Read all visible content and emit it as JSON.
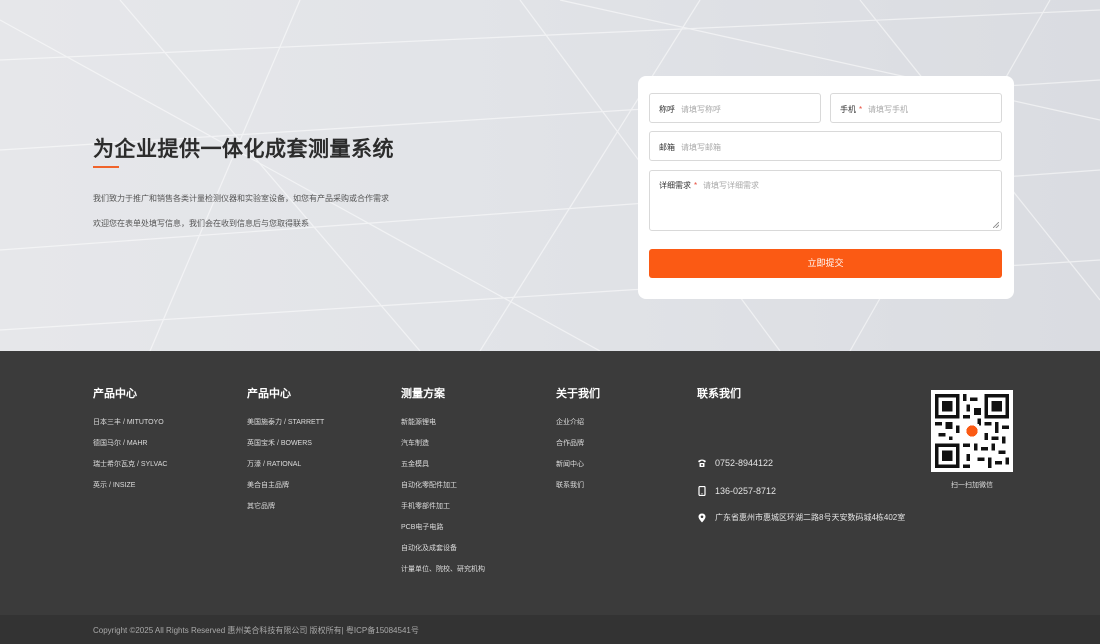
{
  "hero": {
    "title": "为企业提供一体化成套测量系统",
    "desc_line1": "我们致力于推广和销售各类计量检测仪器和实验室设备，如您有产品采购或合作需求",
    "desc_line2": "欢迎您在表单处填写信息，我们会在收到信息后与您取得联系"
  },
  "form": {
    "name_label": "称呼",
    "name_placeholder": "请填写称呼",
    "phone_label": "手机",
    "phone_placeholder": "请填写手机",
    "email_label": "邮箱",
    "email_placeholder": "请填写邮箱",
    "detail_label": "详细需求",
    "detail_placeholder": "请填写详细需求",
    "required_mark": "*",
    "submit_label": "立即提交"
  },
  "footer": {
    "columns": [
      {
        "title": "产品中心",
        "items": [
          "日本三丰 / MITUTOYO",
          "德国马尔 / MAHR",
          "瑞士希尔瓦克 / SYLVAC",
          "英示 / INSIZE"
        ]
      },
      {
        "title": "产品中心",
        "items": [
          "美国施泰力 / STARRETT",
          "英国宝禾 / BOWERS",
          "万濠 / RATIONAL",
          "美合自主品牌",
          "其它品牌"
        ]
      },
      {
        "title": "测量方案",
        "items": [
          "新能源锂电",
          "汽车制造",
          "五金模具",
          "自动化零配件加工",
          "手机零部件加工",
          "PCB电子电路",
          "自动化及成套设备",
          "计量单位、院校、研究机构"
        ]
      },
      {
        "title": "关于我们",
        "items": [
          "企业介绍",
          "合作品牌",
          "新闻中心",
          "联系我们"
        ]
      }
    ],
    "contact": {
      "title": "联系我们",
      "phone": "0752-8944122",
      "mobile": "136-0257-8712",
      "address": "广东省惠州市惠城区环湖二路8号天安数码城4栋402室"
    },
    "qr_caption": "扫一扫加微信",
    "copyright": "Copyright ©2025 All Rights Reserved 惠州美合科技有限公司 版权所有| 粤ICP备15084541号"
  },
  "colors": {
    "accent": "#fb5a14",
    "footer_bg": "#3b3b3b",
    "bottom_bg": "#333333"
  },
  "icons": [
    "phone-icon",
    "mobile-icon",
    "location-icon",
    "qr-code-icon"
  ]
}
